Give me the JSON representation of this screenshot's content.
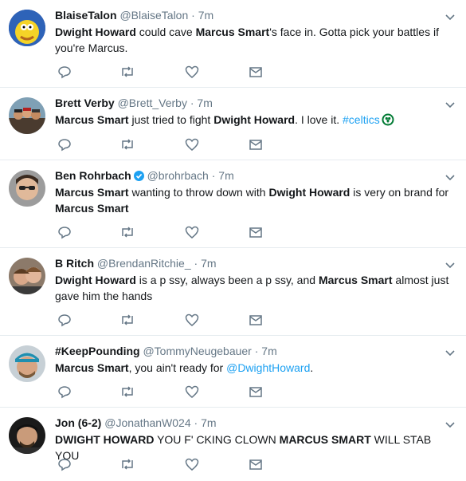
{
  "tweets": [
    {
      "name": "BlaiseTalon",
      "handle": "@BlaiseTalon",
      "time": "7m",
      "verified": false,
      "segments": [
        {
          "t": "Dwight Howard",
          "b": true
        },
        {
          "t": " could cave "
        },
        {
          "t": "Marcus Smart",
          "b": true
        },
        {
          "t": "'s face in. Gotta pick your battles if you're Marcus."
        }
      ]
    },
    {
      "name": "Brett Verby",
      "handle": "@Brett_Verby",
      "time": "7m",
      "verified": false,
      "segments": [
        {
          "t": "Marcus Smart",
          "b": true
        },
        {
          "t": " just tried to fight "
        },
        {
          "t": "Dwight Howard",
          "b": true
        },
        {
          "t": ". I love it. "
        },
        {
          "t": "#celtics",
          "link": true
        }
      ],
      "emoji": "celtics-clover"
    },
    {
      "name": "Ben Rohrbach",
      "handle": "@brohrbach",
      "time": "7m",
      "verified": true,
      "segments": [
        {
          "t": "Marcus Smart",
          "b": true
        },
        {
          "t": " wanting to throw down with "
        },
        {
          "t": "Dwight Howard",
          "b": true
        },
        {
          "t": " is very on brand for "
        },
        {
          "t": "Marcus Smart",
          "b": true
        }
      ]
    },
    {
      "name": "B Ritch",
      "handle": "@BrendanRitchie_",
      "time": "7m",
      "verified": false,
      "segments": [
        {
          "t": "Dwight Howard",
          "b": true
        },
        {
          "t": " is a p   ssy, always been a p   ssy, and "
        },
        {
          "t": "Marcus Smart",
          "b": true
        },
        {
          "t": " almost just gave him the hands"
        }
      ]
    },
    {
      "name": "#KeepPounding",
      "handle": "@TommyNeugebauer",
      "time": "7m",
      "verified": false,
      "segments": [
        {
          "t": "Marcus Smart",
          "b": true
        },
        {
          "t": ", you ain't ready for "
        },
        {
          "t": "@DwightHoward",
          "link": true
        },
        {
          "t": "."
        }
      ]
    },
    {
      "name": "Jon (6-2)",
      "handle": "@JonathanW024",
      "time": "7m",
      "verified": false,
      "segments": [
        {
          "t": "DWIGHT HOWARD",
          "b": true
        },
        {
          "t": " YOU F'  CKING CLOWN "
        },
        {
          "t": "MARCUS SMART",
          "b": true
        },
        {
          "t": " WILL STAB YOU"
        }
      ]
    }
  ],
  "separator": "·",
  "icons": [
    "reply-icon",
    "retweet-icon",
    "like-icon",
    "message-icon",
    "chevron-down-icon",
    "verified-badge-icon"
  ],
  "colors": {
    "text": "#14171a",
    "muted": "#657786",
    "link": "#1da1f2",
    "divider": "#e6ecf0"
  }
}
